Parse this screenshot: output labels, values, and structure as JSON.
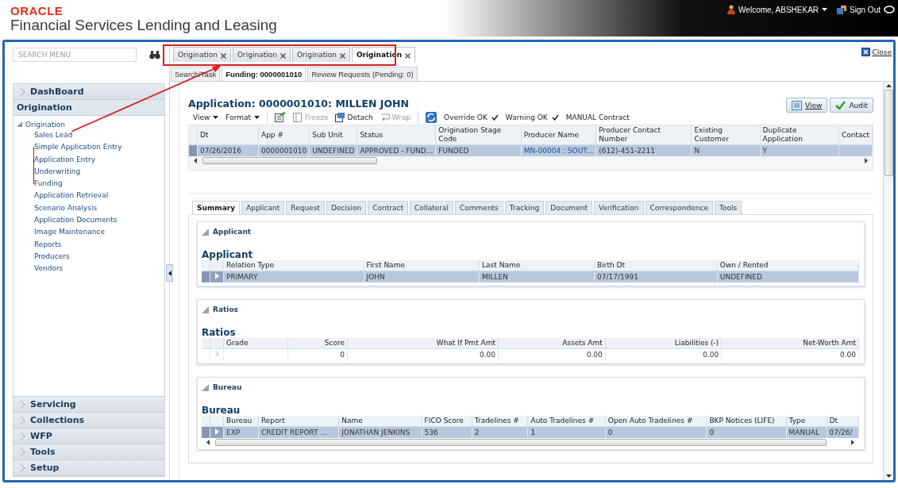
{
  "header": {
    "logo": "ORACLE",
    "product": "Financial Services Lending and Leasing",
    "welcome": "Welcome, ABSHEKAR",
    "sign_out": "Sign Out"
  },
  "sidebar": {
    "search": {
      "placeholder": "SEARCH MENU"
    },
    "sections": [
      {
        "label": "DashBoard",
        "expanded": false
      },
      {
        "label": "Origination",
        "expanded": true,
        "tree": {
          "label": "Origination",
          "expanded": true,
          "children": [
            {
              "label": "Sales Lead"
            },
            {
              "label": "Simple Application Entry"
            },
            {
              "label": "Application Entry"
            },
            {
              "label": "Underwriting"
            },
            {
              "label": "Funding"
            },
            {
              "label": "Application Retrieval"
            },
            {
              "label": "Scenario Analysis"
            },
            {
              "label": "Application Documents"
            },
            {
              "label": "Image Maintenance"
            },
            {
              "label": "Reports"
            },
            {
              "label": "Producers"
            },
            {
              "label": "Vendors"
            }
          ]
        }
      },
      {
        "label": "Servicing",
        "expanded": false
      },
      {
        "label": "Collections",
        "expanded": false
      },
      {
        "label": "WFP",
        "expanded": false
      },
      {
        "label": "Tools",
        "expanded": false
      },
      {
        "label": "Setup",
        "expanded": false
      }
    ]
  },
  "document_tabs": [
    {
      "label": "Origination",
      "selected": false
    },
    {
      "label": "Origination",
      "selected": false
    },
    {
      "label": "Origination",
      "selected": false
    },
    {
      "label": "Origination",
      "selected": true
    }
  ],
  "close_label": "Close",
  "page_tabs": [
    {
      "label": "Search/Task",
      "selected": false
    },
    {
      "label": "Funding: 0000001010",
      "selected": true
    },
    {
      "label": "Review Requests (Pending: 0)",
      "selected": false
    }
  ],
  "application": {
    "title": "Application: 0000001010: MILLEN JOHN",
    "buttons": [
      {
        "label": "View",
        "kind": "view"
      },
      {
        "label": "Audit",
        "kind": "audit"
      }
    ],
    "toolbar": [
      {
        "kind": "menu",
        "label": "View"
      },
      {
        "kind": "menu",
        "label": "Format"
      },
      {
        "kind": "export"
      },
      {
        "kind": "freeze",
        "label": "Freeze",
        "disabled": true
      },
      {
        "kind": "detach",
        "label": "Detach",
        "disabled": false
      },
      {
        "kind": "wrap",
        "label": "Wrap",
        "disabled": true
      },
      {
        "kind": "refresh"
      },
      {
        "kind": "check",
        "label": "Override OK",
        "checked": true
      },
      {
        "kind": "check",
        "label": "Warning OK",
        "checked": true
      },
      {
        "kind": "text",
        "label": "MANUAL Contract"
      }
    ],
    "grid": {
      "columns": [
        {
          "label": "Dt"
        },
        {
          "label": "App #"
        },
        {
          "label": "Sub Unit"
        },
        {
          "label": "Status"
        },
        {
          "label": "Origination Stage Code"
        },
        {
          "label": "Producer Name"
        },
        {
          "label": "Producer Contact Number"
        },
        {
          "label": "Existing Customer"
        },
        {
          "label": "Duplicate Application"
        },
        {
          "label": "Contact"
        }
      ],
      "rows": [
        {
          "selected": true,
          "cells": [
            "07/26/2016",
            "0000001010",
            "UNDEFINED",
            "APPROVED - FUND...",
            "FUNDED",
            "MN-00004 : SOUT...",
            "(612)-451-2211",
            "N",
            "Y",
            ""
          ]
        }
      ]
    }
  },
  "detail_tabs": [
    {
      "label": "Summary",
      "selected": true
    },
    {
      "label": "Applicant",
      "selected": false
    },
    {
      "label": "Request",
      "selected": false
    },
    {
      "label": "Decision",
      "selected": false
    },
    {
      "label": "Contract",
      "selected": false
    },
    {
      "label": "Collateral",
      "selected": false
    },
    {
      "label": "Comments",
      "selected": false
    },
    {
      "label": "Tracking",
      "selected": false
    },
    {
      "label": "Document",
      "selected": false
    },
    {
      "label": "Verification",
      "selected": false
    },
    {
      "label": "Correspondence",
      "selected": false
    },
    {
      "label": "Tools",
      "selected": false
    }
  ],
  "panels": [
    {
      "title": "Applicant",
      "heading": "Applicant",
      "table": {
        "columns": [
          {
            "label": "Relation Type"
          },
          {
            "label": "First Name"
          },
          {
            "label": "Last Name"
          },
          {
            "label": "Birth Dt"
          },
          {
            "label": "Own / Rented"
          }
        ],
        "rows": [
          {
            "selected": true,
            "cells": [
              "PRIMARY",
              "JOHN",
              "MILLEN",
              "07/17/1991",
              "UNDEFINED"
            ]
          }
        ]
      }
    },
    {
      "title": "Ratios",
      "heading": "Ratios",
      "table": {
        "columns": [
          {
            "label": "Grade",
            "kind": "text"
          },
          {
            "label": "Score",
            "kind": "number"
          },
          {
            "label": "What If Pmt Amt",
            "kind": "number"
          },
          {
            "label": "Assets Amt",
            "kind": "number"
          },
          {
            "label": "Liabilities (-)",
            "kind": "number"
          },
          {
            "label": "Net-Worth Amt",
            "kind": "number"
          }
        ],
        "rows": [
          {
            "selected": false,
            "cells": [
              "",
              "0",
              "0.00",
              "0.00",
              "0.00",
              "0.00"
            ]
          }
        ]
      }
    },
    {
      "title": "Bureau",
      "heading": "Bureau",
      "scrollbar": true,
      "table": {
        "columns": [
          {
            "label": "Bureau"
          },
          {
            "label": "Report"
          },
          {
            "label": "Name"
          },
          {
            "label": "FICO Score"
          },
          {
            "label": "Tradelines #"
          },
          {
            "label": "Auto Tradelines #"
          },
          {
            "label": "Open Auto Tradelines #"
          },
          {
            "label": "BKP Notices (LIFE)"
          },
          {
            "label": "Type"
          },
          {
            "label": "Dt"
          }
        ],
        "rows": [
          {
            "selected": true,
            "cells": [
              "EXP",
              "CREDIT REPORT ...",
              "JONATHAN JENKINS",
              "536",
              "2",
              "1",
              "0",
              "0",
              "MANUAL",
              "07/26/"
            ]
          }
        ]
      }
    }
  ]
}
